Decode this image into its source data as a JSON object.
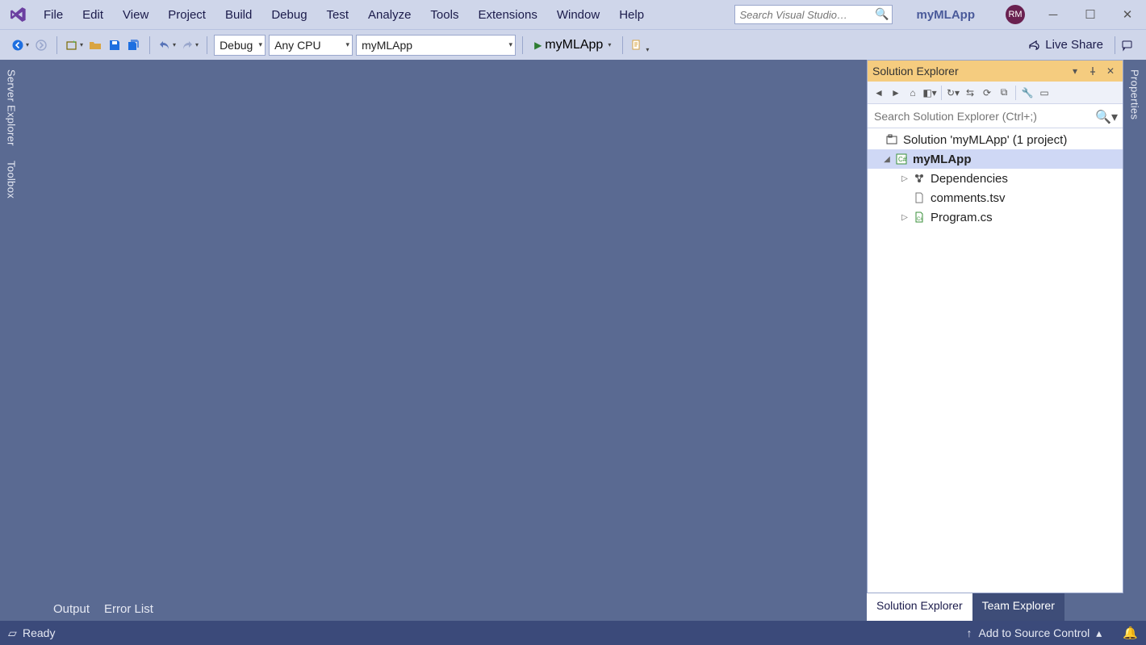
{
  "menu": {
    "items": [
      "File",
      "Edit",
      "View",
      "Project",
      "Build",
      "Debug",
      "Test",
      "Analyze",
      "Tools",
      "Extensions",
      "Window",
      "Help"
    ]
  },
  "quick_launch": {
    "placeholder": "Search Visual Studio…"
  },
  "app_title": "myMLApp",
  "user_initials": "RM",
  "toolbar": {
    "config": "Debug",
    "platform": "Any CPU",
    "startup_project": "myMLApp",
    "start_label": "myMLApp",
    "live_share": "Live Share"
  },
  "left_tabs": {
    "server_explorer": "Server Explorer",
    "toolbox": "Toolbox"
  },
  "right_tabs": {
    "properties": "Properties"
  },
  "solution_explorer": {
    "title": "Solution Explorer",
    "search_placeholder": "Search Solution Explorer (Ctrl+;)",
    "solution_label": "Solution 'myMLApp' (1 project)",
    "project_label": "myMLApp",
    "nodes": {
      "dependencies": "Dependencies",
      "comments": "comments.tsv",
      "program": "Program.cs"
    },
    "tabs": {
      "solution": "Solution Explorer",
      "team": "Team Explorer"
    }
  },
  "bottom_tabs": {
    "output": "Output",
    "error_list": "Error List"
  },
  "status": {
    "ready": "Ready",
    "source_control": "Add to Source Control"
  }
}
